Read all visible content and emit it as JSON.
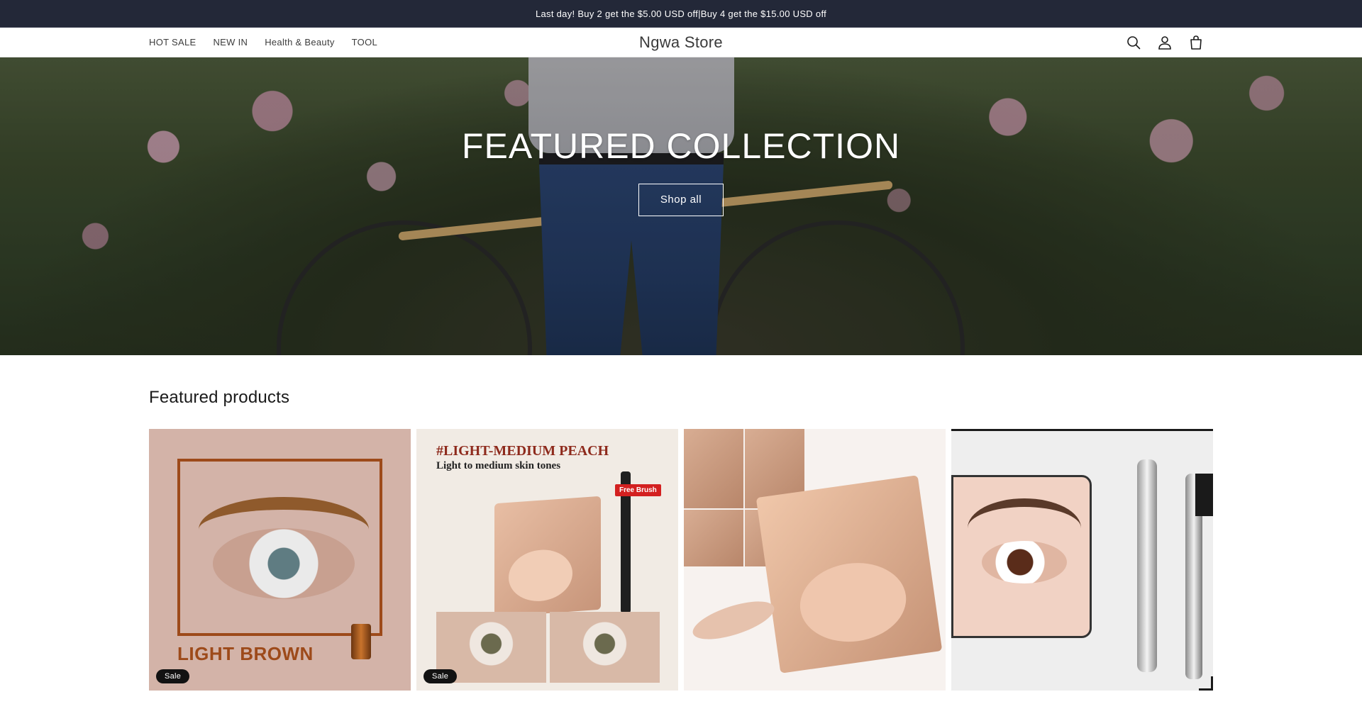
{
  "announcement": {
    "text": "Last day!  Buy 2 get the  $5.00 USD off|Buy 4 get the  $15.00 USD off"
  },
  "header": {
    "brand": "Ngwa Store",
    "nav": [
      {
        "label": "HOT SALE"
      },
      {
        "label": "NEW IN"
      },
      {
        "label": "Health & Beauty"
      },
      {
        "label": "TOOL"
      }
    ],
    "icons": [
      "search-icon",
      "account-icon",
      "cart-icon"
    ]
  },
  "hero": {
    "title": "FEATURED COLLECTION",
    "button_label": "Shop all"
  },
  "featured": {
    "title": "Featured products",
    "products": [
      {
        "badge": "Sale",
        "image_text": "LIGHT BROWN"
      },
      {
        "badge": "Sale",
        "image_heading": "#LIGHT-MEDIUM PEACH",
        "image_sub": "Light to medium skin tones",
        "image_tag": "Free Brush"
      },
      {
        "badge": ""
      },
      {
        "badge": ""
      }
    ]
  },
  "colors": {
    "announcement_bg": "#232838",
    "badge_bg": "#121212",
    "accent_brown": "#9d4a1a"
  }
}
